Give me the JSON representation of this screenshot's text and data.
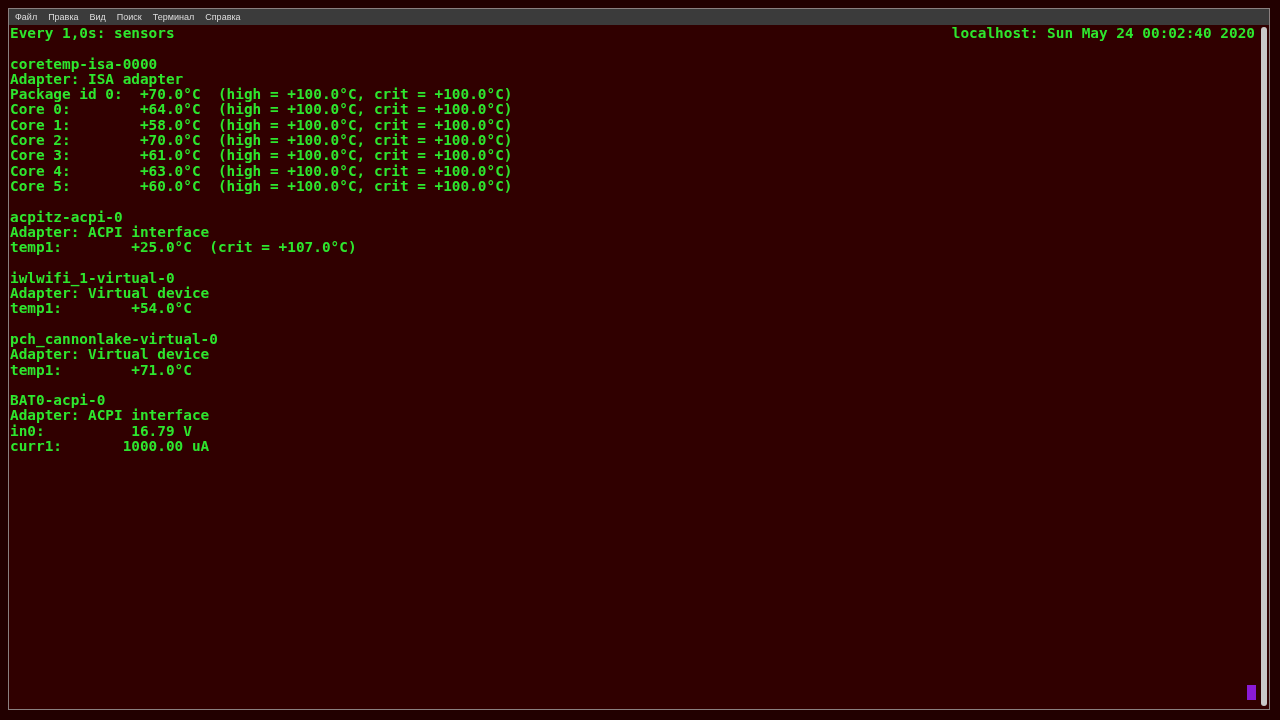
{
  "menu": [
    "Файл",
    "Правка",
    "Вид",
    "Поиск",
    "Терминал",
    "Справка"
  ],
  "header": {
    "left": "Every 1,0s: sensors",
    "right": "localhost: Sun May 24 00:02:40 2020"
  },
  "blocks": [
    {
      "lines": [
        "coretemp-isa-0000",
        "Adapter: ISA adapter",
        "Package id 0:  +70.0°C  (high = +100.0°C, crit = +100.0°C)",
        "Core 0:        +64.0°C  (high = +100.0°C, crit = +100.0°C)",
        "Core 1:        +58.0°C  (high = +100.0°C, crit = +100.0°C)",
        "Core 2:        +70.0°C  (high = +100.0°C, crit = +100.0°C)",
        "Core 3:        +61.0°C  (high = +100.0°C, crit = +100.0°C)",
        "Core 4:        +63.0°C  (high = +100.0°C, crit = +100.0°C)",
        "Core 5:        +60.0°C  (high = +100.0°C, crit = +100.0°C)"
      ]
    },
    {
      "lines": [
        "acpitz-acpi-0",
        "Adapter: ACPI interface",
        "temp1:        +25.0°C  (crit = +107.0°C)"
      ]
    },
    {
      "lines": [
        "iwlwifi_1-virtual-0",
        "Adapter: Virtual device",
        "temp1:        +54.0°C"
      ]
    },
    {
      "lines": [
        "pch_cannonlake-virtual-0",
        "Adapter: Virtual device",
        "temp1:        +71.0°C"
      ]
    },
    {
      "lines": [
        "BAT0-acpi-0",
        "Adapter: ACPI interface",
        "in0:          16.79 V",
        "curr1:       1000.00 uA"
      ]
    }
  ]
}
